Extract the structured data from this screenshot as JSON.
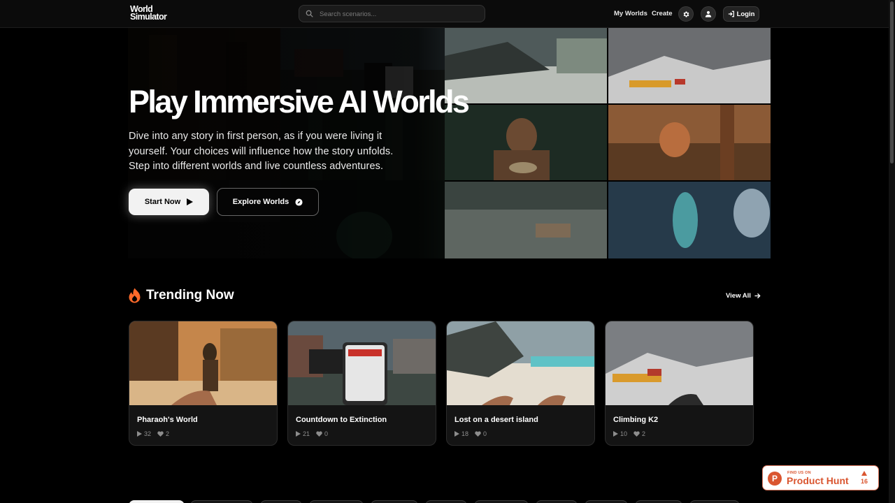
{
  "header": {
    "logo_line1": "World",
    "logo_line2": "Simulator",
    "search_placeholder": "Search scenarios...",
    "nav": {
      "my_worlds": "My Worlds",
      "create": "Create",
      "login": "Login"
    },
    "icons": {
      "search": "search-icon",
      "settings": "gear-icon",
      "user": "user-icon",
      "login": "sign-in-icon"
    }
  },
  "hero": {
    "title": "Play Immersive AI Worlds",
    "description": "Dive into any story in first person, as if you were living it yourself. Your choices will influence how the story unfolds. Step into different worlds and live countless adventures.",
    "start_label": "Start Now",
    "explore_label": "Explore Worlds",
    "icons": {
      "start": "play-icon",
      "explore": "compass-icon"
    }
  },
  "trending": {
    "title": "Trending Now",
    "view_all": "View All",
    "icon": "fire-icon",
    "cards": [
      {
        "title": "Pharaoh's World",
        "plays": "32",
        "likes": "2"
      },
      {
        "title": "Countdown to Extinction",
        "plays": "21",
        "likes": "0"
      },
      {
        "title": "Lost on a desert island",
        "plays": "18",
        "likes": "0"
      },
      {
        "title": "Climbing K2",
        "plays": "10",
        "likes": "2"
      }
    ]
  },
  "product_hunt": {
    "small": "FIND US ON",
    "big": "Product Hunt",
    "count": "16",
    "logo_letter": "P"
  },
  "colors": {
    "background": "#000000",
    "accent_fire": "#ff6a2a",
    "product_hunt": "#da552f"
  }
}
